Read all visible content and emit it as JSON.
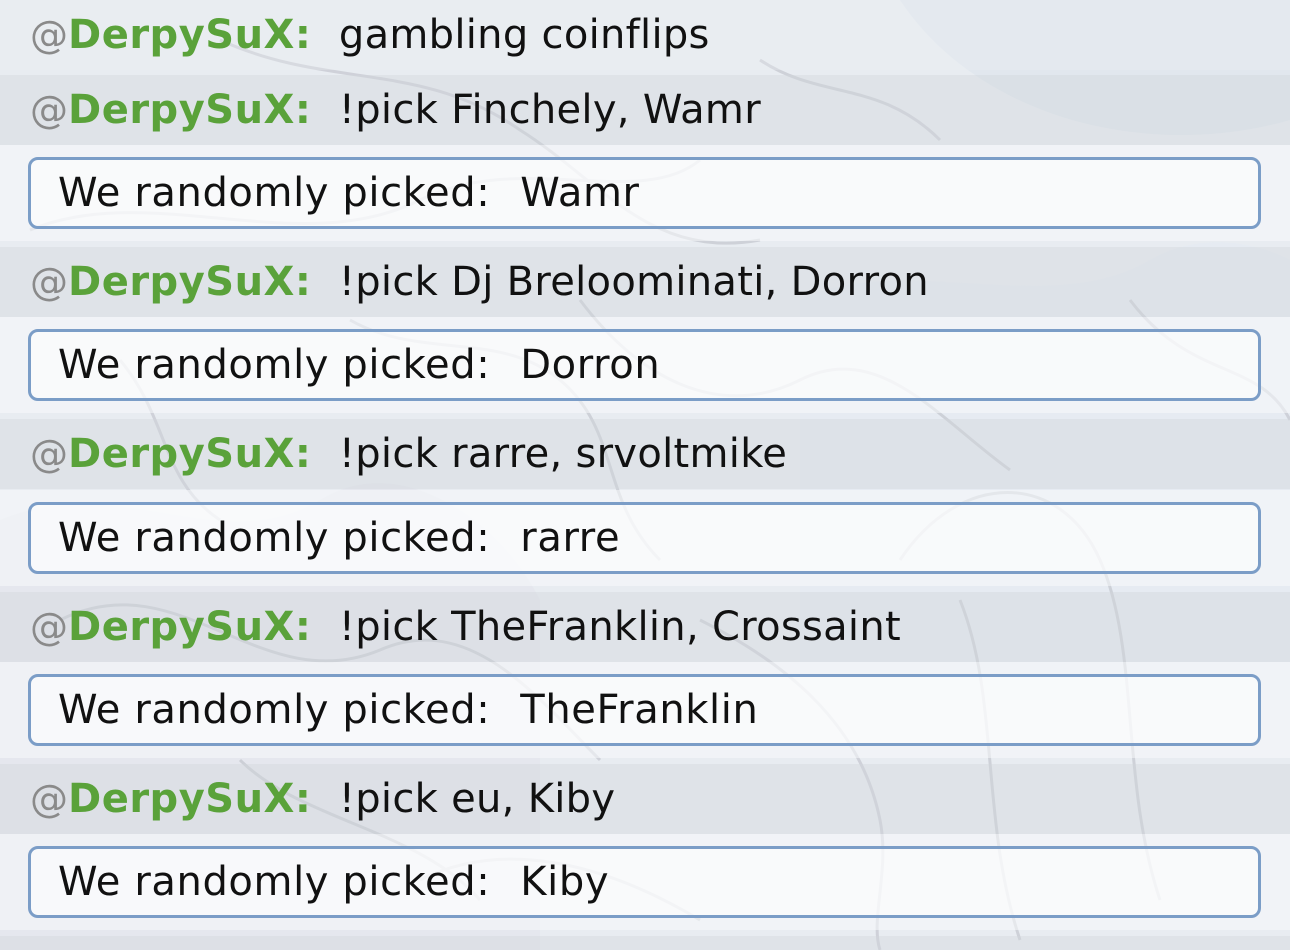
{
  "messages": [
    {
      "at": "@",
      "user": "DerpySuX",
      "colon": ":",
      "text": "gambling coinflips"
    },
    {
      "at": "@",
      "user": "DerpySuX",
      "colon": ":",
      "text": "!pick Finchely, Wamr"
    },
    {
      "at": "@",
      "user": "DerpySuX",
      "colon": ":",
      "text": "!pick Dj Breloominati, Dorron"
    },
    {
      "at": "@",
      "user": "DerpySuX",
      "colon": ":",
      "text": "!pick rarre, srvoltmike"
    },
    {
      "at": "@",
      "user": "DerpySuX",
      "colon": ":",
      "text": "!pick TheFranklin, Crossaint"
    },
    {
      "at": "@",
      "user": "DerpySuX",
      "colon": ":",
      "text": "!pick eu, Kiby"
    }
  ],
  "bot_prefix": "We randomly picked:",
  "results": [
    "Wamr",
    "Dorron",
    "rarre",
    "TheFranklin",
    "Kiby"
  ],
  "colors": {
    "username": "#5aa23a",
    "at_symbol": "#8a8a8a",
    "box_border": "#7b9dc7"
  }
}
